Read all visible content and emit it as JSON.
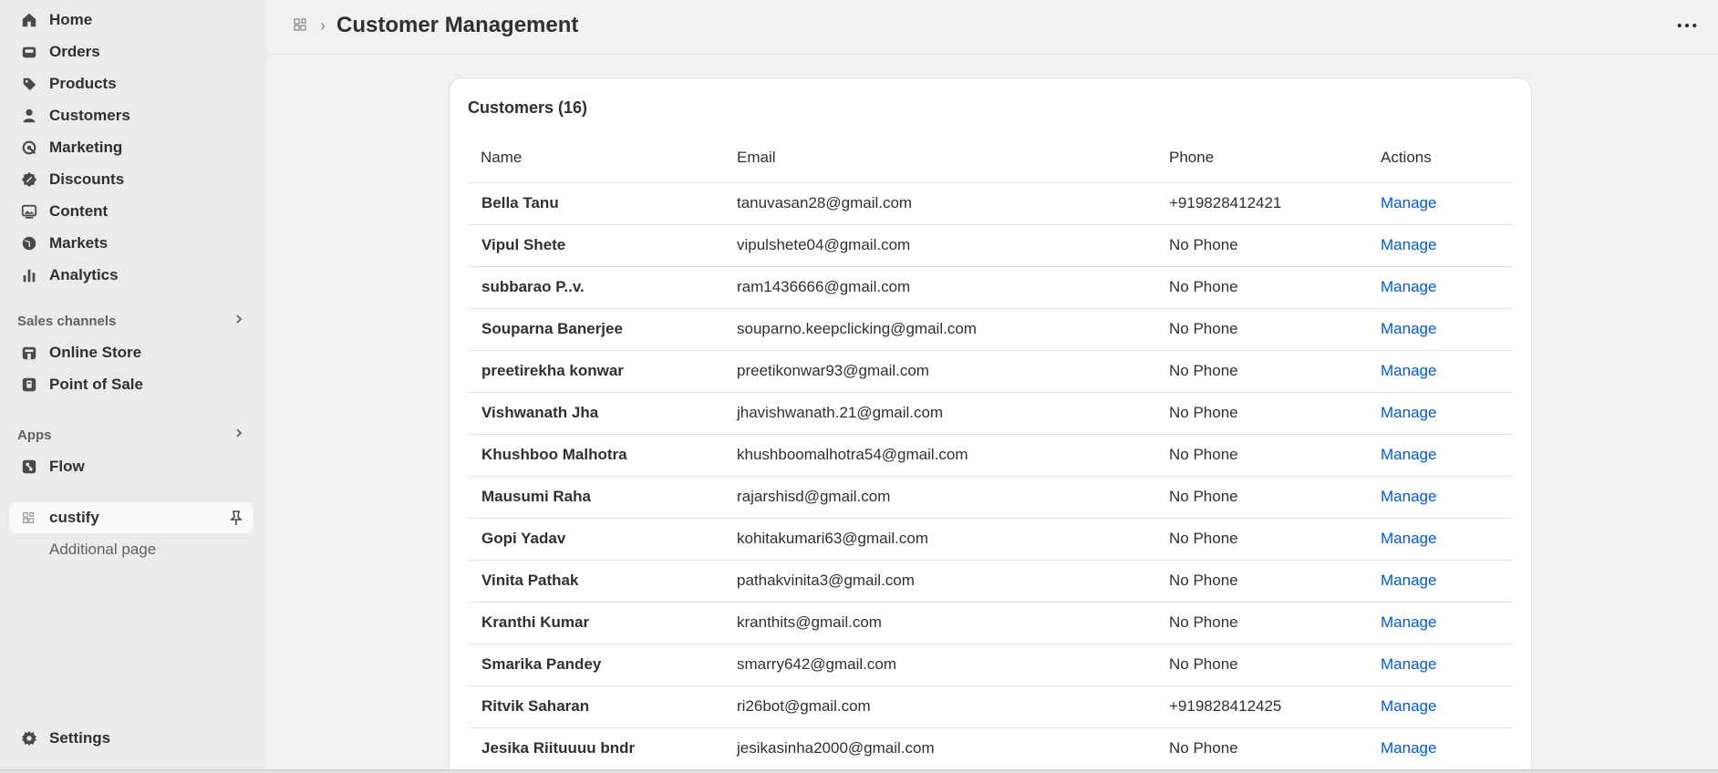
{
  "sidebar": {
    "main_items": [
      {
        "label": "Home",
        "icon": "home-icon"
      },
      {
        "label": "Orders",
        "icon": "inbox-icon"
      },
      {
        "label": "Products",
        "icon": "tag-icon"
      },
      {
        "label": "Customers",
        "icon": "person-icon"
      },
      {
        "label": "Marketing",
        "icon": "target-icon"
      },
      {
        "label": "Discounts",
        "icon": "discount-icon"
      },
      {
        "label": "Content",
        "icon": "image-icon"
      },
      {
        "label": "Markets",
        "icon": "globe-icon"
      },
      {
        "label": "Analytics",
        "icon": "bar-chart-icon"
      }
    ],
    "sales_channels_label": "Sales channels",
    "sales_channels": [
      {
        "label": "Online Store",
        "icon": "store-icon"
      },
      {
        "label": "Point of Sale",
        "icon": "pos-icon"
      }
    ],
    "apps_label": "Apps",
    "apps": [
      {
        "label": "Flow",
        "icon": "flow-icon"
      }
    ],
    "active_app": {
      "label": "custify",
      "icon": "app-grid-icon",
      "sub_item": "Additional page"
    },
    "settings_label": "Settings"
  },
  "header": {
    "title": "Customer Management"
  },
  "card": {
    "title": "Customers (16)",
    "columns": [
      "Name",
      "Email",
      "Phone",
      "Actions"
    ],
    "rows": [
      {
        "name": "Bella Tanu",
        "email": "tanuvasan28@gmail.com",
        "phone": "+919828412421",
        "action": "Manage"
      },
      {
        "name": "Vipul Shete",
        "email": "vipulshete04@gmail.com",
        "phone": "No Phone",
        "action": "Manage"
      },
      {
        "name": "subbarao P..v.",
        "email": "ram1436666@gmail.com",
        "phone": "No Phone",
        "action": "Manage"
      },
      {
        "name": "Souparna Banerjee",
        "email": "souparno.keepclicking@gmail.com",
        "phone": "No Phone",
        "action": "Manage"
      },
      {
        "name": "preetirekha konwar",
        "email": "preetikonwar93@gmail.com",
        "phone": "No Phone",
        "action": "Manage"
      },
      {
        "name": "Vishwanath Jha",
        "email": "jhavishwanath.21@gmail.com",
        "phone": "No Phone",
        "action": "Manage"
      },
      {
        "name": "Khushboo Malhotra",
        "email": "khushboomalhotra54@gmail.com",
        "phone": "No Phone",
        "action": "Manage"
      },
      {
        "name": "Mausumi Raha",
        "email": "rajarshisd@gmail.com",
        "phone": "No Phone",
        "action": "Manage"
      },
      {
        "name": "Gopi Yadav",
        "email": "kohitakumari63@gmail.com",
        "phone": "No Phone",
        "action": "Manage"
      },
      {
        "name": "Vinita Pathak",
        "email": "pathakvinita3@gmail.com",
        "phone": "No Phone",
        "action": "Manage"
      },
      {
        "name": "Kranthi Kumar",
        "email": "kranthits@gmail.com",
        "phone": "No Phone",
        "action": "Manage"
      },
      {
        "name": "Smarika Pandey",
        "email": "smarry642@gmail.com",
        "phone": "No Phone",
        "action": "Manage"
      },
      {
        "name": "Ritvik Saharan",
        "email": "ri26bot@gmail.com",
        "phone": "+919828412425",
        "action": "Manage"
      },
      {
        "name": "Jesika Riituuuu bndr",
        "email": "jesikasinha2000@gmail.com",
        "phone": "No Phone",
        "action": "Manage"
      }
    ]
  },
  "colors": {
    "link": "#005bd3",
    "sidebar_bg": "#ebebeb",
    "page_bg": "#f1f1f1"
  }
}
